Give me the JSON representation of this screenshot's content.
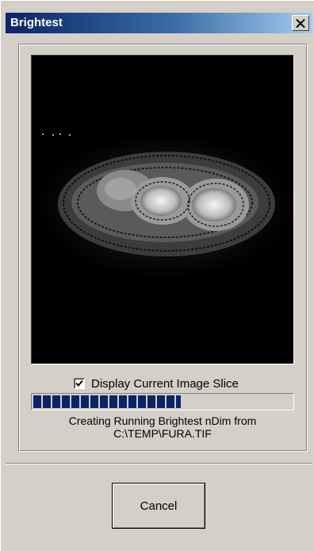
{
  "window": {
    "title": "Brightest",
    "close_icon": "close-icon"
  },
  "preview": {
    "content": "fluorescence-image-slice"
  },
  "display_slice": {
    "label": "Display Current Image Slice",
    "checked": true
  },
  "progress": {
    "fraction": 0.57,
    "color": "#0a246a"
  },
  "status": {
    "line1": "Creating Running Brightest nDim from",
    "line2": "C:\\TEMP\\FURA.TIF"
  },
  "buttons": {
    "cancel_label": "Cancel"
  }
}
